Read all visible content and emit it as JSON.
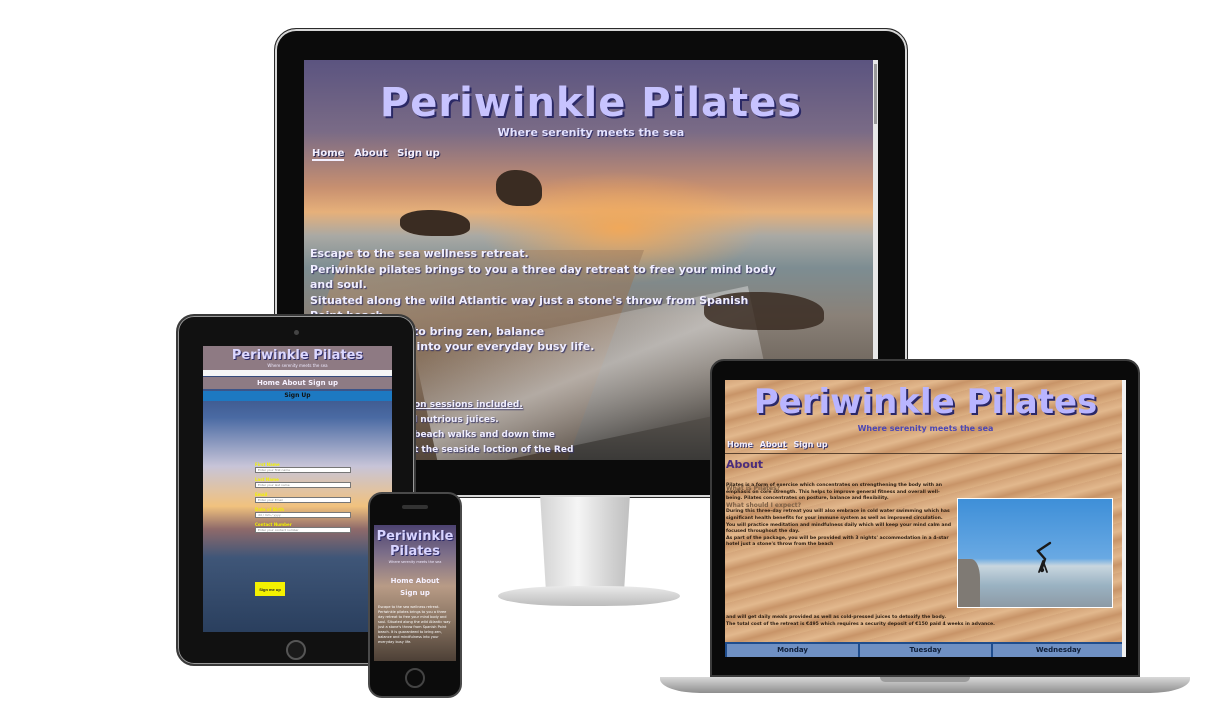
{
  "site": {
    "title": "Periwinkle Pilates",
    "subtitle": "Where serenity meets the sea",
    "nav": [
      "Home",
      "About",
      "Sign up"
    ]
  },
  "desktop": {
    "intro_lines": [
      "Escape to the sea wellness retreat.",
      "Periwinkle pilates brings to you a three day retreat to free your mind body and soul.",
      "Situated along the wild Atlantic way just a stone's throw from Spanish Point beach.",
      "It is guaranteed to bring zen, balance",
      "and mindfulness into your everyday busy life."
    ],
    "list_items": [
      "on sessions included.",
      "l nutrious juices.",
      "beach walks and down time",
      "t the seaside loction of the Red"
    ]
  },
  "tablet": {
    "nav_text": "Home About Sign up",
    "signup_heading": "Sign Up",
    "fields": [
      {
        "label": "First Name",
        "placeholder": "Enter your first name"
      },
      {
        "label": "Last Name",
        "placeholder": "Enter your last name"
      },
      {
        "label": "Email",
        "placeholder": "Enter your Email"
      },
      {
        "label": "Date of Birth",
        "placeholder": "dd / mm / yyyy"
      },
      {
        "label": "Contact Number",
        "placeholder": "Enter your contact number"
      }
    ],
    "submit_label": "Sign me up"
  },
  "phone": {
    "title_line1": "Periwinkle",
    "title_line2": "Pilates",
    "nav_line1": "Home  About",
    "nav_line2": "Sign up",
    "body": "Escape to the sea wellness retreat. Periwinkle pilates brings to you a three day retreat to free your mind body and soul. Situated along the wild Atlantic way just a stone's throw from Spanish Point beach. It is guaranteed to bring zen, balance and mindfulness into your everyday busy life."
  },
  "laptop": {
    "section_title": "About",
    "q1": "What is Pilates?",
    "p1": "Pilates is a form of exercise which concentrates on strengthening the body with an emphasis on core strength. This helps to improve general fitness and overall well-being. Pilates concentrates on posture, balance and flexibility.",
    "q2": "What should I expect?",
    "p2": "During this three-day retreat you will also embrace in cold water swimming which has significant health benefits for your immune system as well as improved circulation.",
    "p3": "You will practice meditation and mindfulness daily which will keep your mind calm and focused throughout the day.",
    "p4": "As part of the package, you will be provided with 3 nights' accommodation in a 4-star hotel just a stone's throw from the beach",
    "p5": "and will get daily meals provided as well as cold-pressed juices to detoxify the body.",
    "p6": "The total cost of the retreat is €495 which requires a security deposit of €150 paid 4 weeks in advance.",
    "table_headers": [
      "Monday",
      "Tuesday",
      "Wednesday"
    ]
  },
  "colors": {
    "title_periwinkle": "#c7c3ff",
    "title_shadow": "#2b2966",
    "signup_blue": "#1d79c2",
    "submit_yellow": "#f4f100",
    "about_heading": "#4a2c7c",
    "table_blue": "#1f4d8d"
  }
}
